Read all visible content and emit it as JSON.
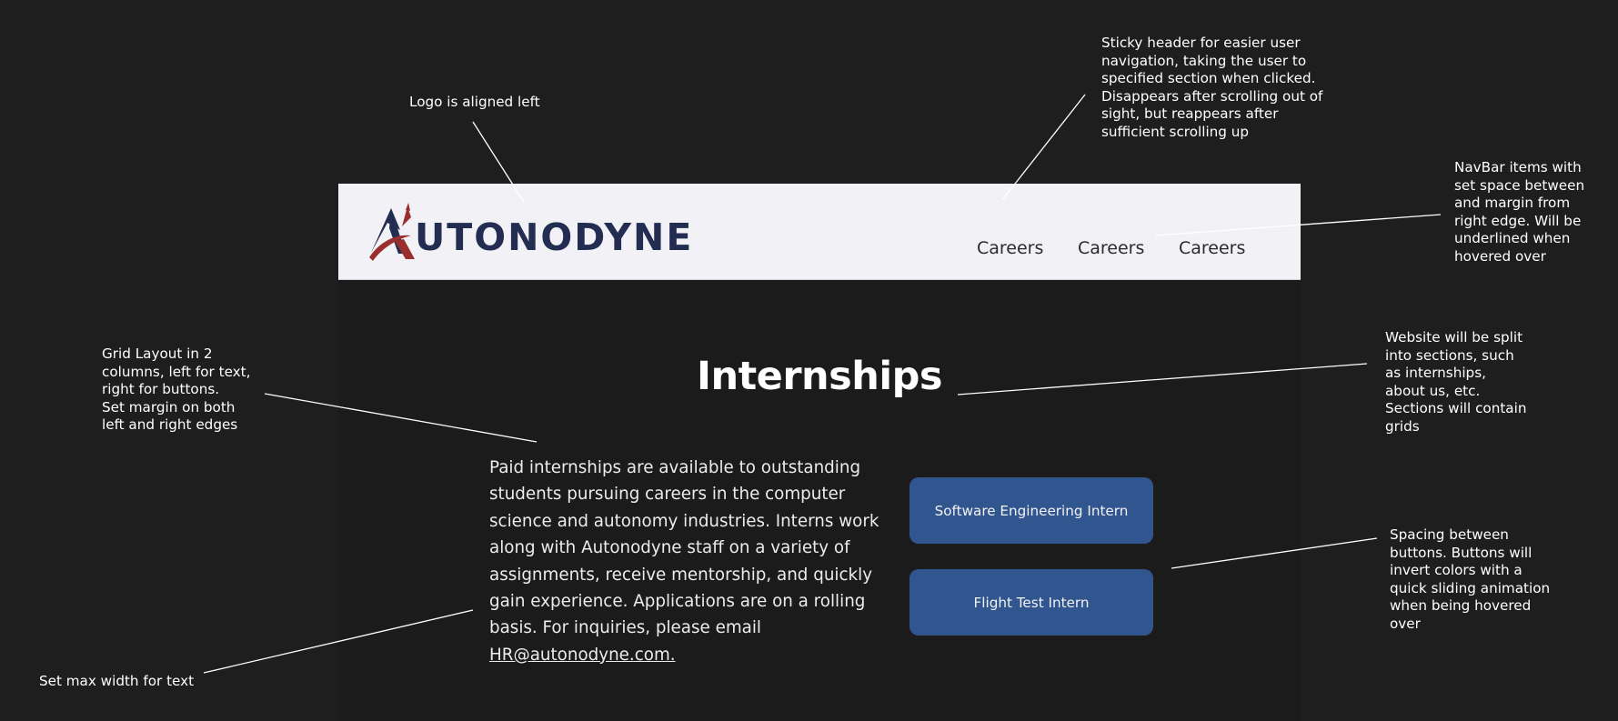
{
  "annotations": {
    "logo": "Logo is aligned left",
    "sticky_header": "Sticky header for easier user\nnavigation, taking the user to\nspecified section when clicked.\nDisappears after scrolling out of\nsight, but reappears after\nsufficient scrolling up",
    "navbar": "NavBar items with\nset space between\nand margin from\nright edge. Will be\nunderlined when\nhovered over",
    "grid": "Grid Layout in 2\ncolumns, left for text,\nright for buttons.\nSet margin on both\nleft and right edges",
    "sections": "Website will be split\ninto sections, such\nas internships,\nabout us, etc.\nSections will contain\ngrids",
    "spacing": "Spacing between\nbuttons. Buttons will\ninvert colors with a\nquick sliding animation\nwhen being hovered\nover",
    "max_width": "Set max width for text"
  },
  "header": {
    "logo_text": "UTONODYNE",
    "logo_alt": "AUTONODYNE",
    "nav": [
      {
        "label": "Careers"
      },
      {
        "label": "Careers"
      },
      {
        "label": "Careers"
      }
    ]
  },
  "main": {
    "title": "Internships",
    "intro_text": "Paid internships are available to outstanding students pursuing careers in the computer science and autonomy industries. Interns work along with Autonodyne staff on a variety of assignments, receive mentorship, and quickly gain experience. Applications are on a rolling basis. For inquiries, please email ",
    "email": "HR@autonodyne.com.",
    "buttons": [
      {
        "label": "Software Engineering Intern"
      },
      {
        "label": "Flight Test Intern"
      }
    ]
  },
  "colors": {
    "canvas_bg": "#1e1e1e",
    "site_bg": "#1b1b1b",
    "header_bg": "#f2f1f6",
    "logo_navy": "#232d52",
    "logo_red": "#9a2e2e",
    "button_blue": "#31568f"
  },
  "icons": {
    "logo_mark": "mountain-with-swoosh-icon"
  }
}
